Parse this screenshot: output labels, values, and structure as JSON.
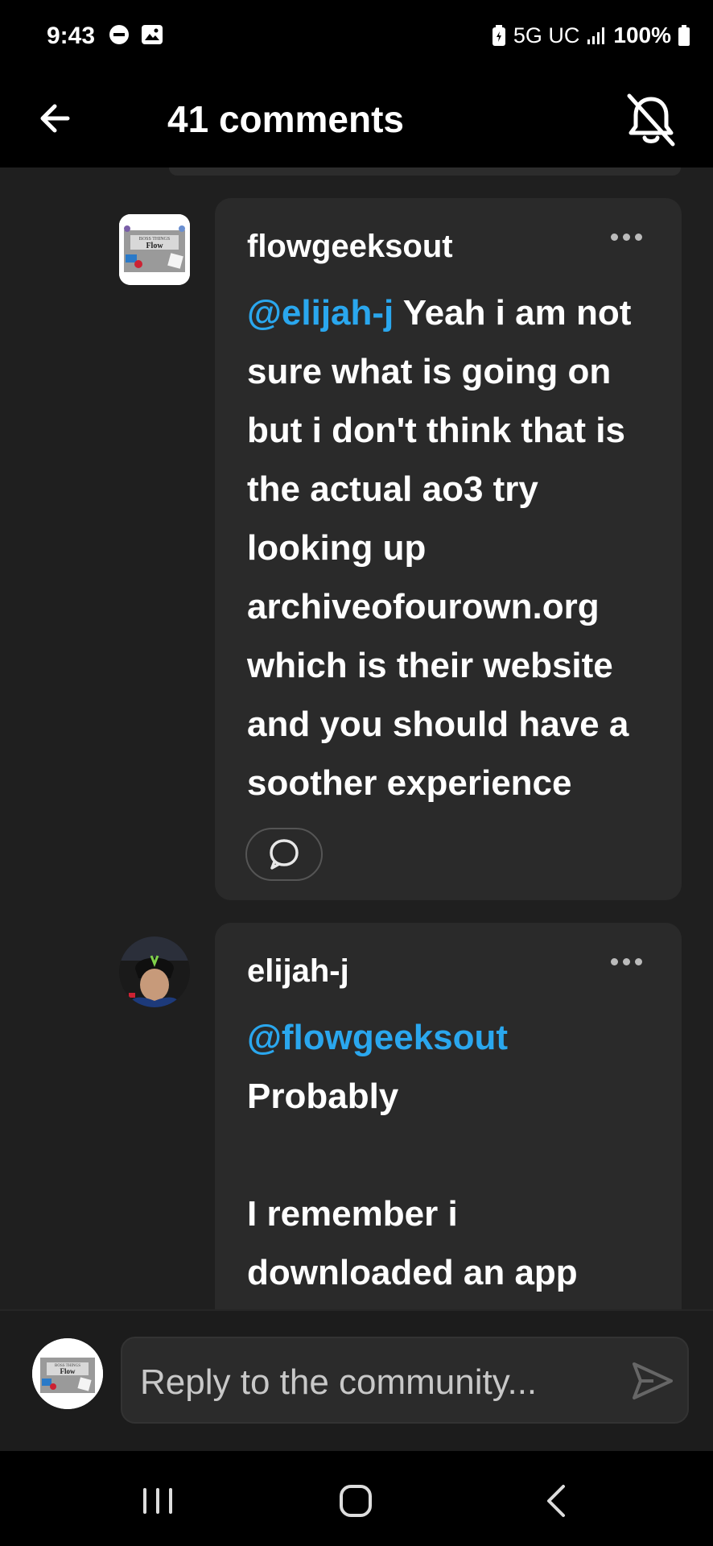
{
  "status_bar": {
    "time": "9:43",
    "network": "5G UC",
    "battery": "100%"
  },
  "header": {
    "title": "41 comments"
  },
  "thumbnail": {
    "caption_top": "BOSS THINGS",
    "caption_main": "Flow"
  },
  "comments": [
    {
      "author": "flowgeeksout",
      "mention": "@elijah-j",
      "text": " Yeah i am not sure what is going on but i don't think that is the actual ao3 try looking up archiveofourown.org which is their website and you should have a soother experience"
    },
    {
      "author": "elijah-j",
      "mention": "@flowgeeksout",
      "text": "Probably\n\nI remember i downloaded an app"
    }
  ],
  "composer": {
    "placeholder": "Reply to the community..."
  },
  "colors": {
    "mention": "#2aa7ee",
    "card": "#2a2a2a",
    "background": "#1f1f1f"
  }
}
